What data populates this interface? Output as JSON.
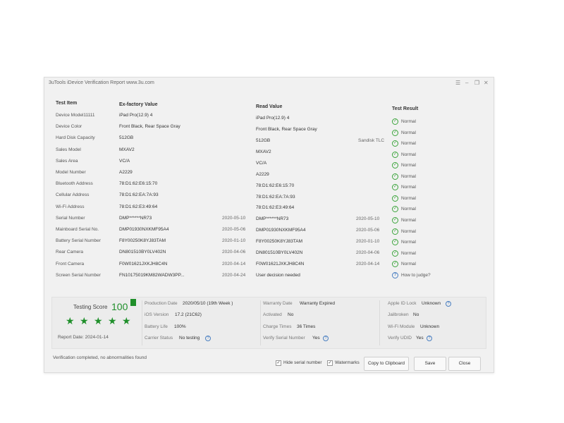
{
  "window": {
    "title": "3uTools iDevice Verification Report www.3u.com",
    "controls": {
      "menu": "☰",
      "minimize": "–",
      "restore": "❐",
      "close": "✕"
    }
  },
  "table": {
    "headers": {
      "item": "Test Item",
      "ex": "Ex-factory Value",
      "read": "Read Value",
      "result": "Test Result"
    },
    "rows": [
      {
        "item": "Device Model11111",
        "ex": "iPad Pro(12.9) 4",
        "ex_date": "",
        "read": "iPad Pro(12.9) 4",
        "read_date": "",
        "note": "",
        "result": "Normal"
      },
      {
        "item": "Device Color",
        "ex": "Front Black,  Rear Space Gray",
        "ex_date": "",
        "read": "Front Black,  Rear Space Gray",
        "read_date": "",
        "note": "",
        "result": "Normal"
      },
      {
        "item": "Hard Disk Capacity",
        "ex": "512GB",
        "ex_date": "",
        "read": "512GB",
        "read_date": "",
        "note": "Sandisk TLC",
        "result": "Normal"
      },
      {
        "item": "Sales Model",
        "ex": "MXAV2",
        "ex_date": "",
        "read": "MXAV2",
        "read_date": "",
        "note": "",
        "result": "Normal"
      },
      {
        "item": "Sales Area",
        "ex": "VC/A",
        "ex_date": "",
        "read": "VC/A",
        "read_date": "",
        "note": "",
        "result": "Normal"
      },
      {
        "item": "Model Number",
        "ex": "A2229",
        "ex_date": "",
        "read": "A2229",
        "read_date": "",
        "note": "",
        "result": "Normal"
      },
      {
        "item": "Bluetooth Address",
        "ex": "78:D1:62:E6:15:70",
        "ex_date": "",
        "read": "78:D1:62:E6:15:70",
        "read_date": "",
        "note": "",
        "result": "Normal"
      },
      {
        "item": "Cellular Address",
        "ex": "78:D1:62:EA:7A:93",
        "ex_date": "",
        "read": "78:D1:62:EA:7A:93",
        "read_date": "",
        "note": "",
        "result": "Normal"
      },
      {
        "item": "Wi-Fi Address",
        "ex": "78:D1:62:E3:49:64",
        "ex_date": "",
        "read": "78:D1:62:E3:49:64",
        "read_date": "",
        "note": "",
        "result": "Normal"
      },
      {
        "item": "Serial Number",
        "ex": "DMP******NR73",
        "ex_date": "2020-05-10",
        "read": "DMP******NR73",
        "read_date": "2020-05-10",
        "note": "",
        "result": "Normal"
      },
      {
        "item": "Mainboard Serial No.",
        "ex": "DMP01930NXKMF95A4",
        "ex_date": "2020-05-06",
        "read": "DMP01930NXKMF95A4",
        "read_date": "2020-05-06",
        "note": "",
        "result": "Normal"
      },
      {
        "item": "Battery Serial Number",
        "ex": "F8Y00250K8YJ83TAM",
        "ex_date": "2020-01-10",
        "read": "F8Y00250K8YJ83TAM",
        "read_date": "2020-01-10",
        "note": "",
        "result": "Normal"
      },
      {
        "item": "Rear Camera",
        "ex": "DN801510BY0LV402N",
        "ex_date": "2020-04-06",
        "read": "DN801510BY0LV402N",
        "read_date": "2020-04-06",
        "note": "",
        "result": "Normal"
      },
      {
        "item": "Front Camera",
        "ex": "F0W01621JXKJH8C4N",
        "ex_date": "2020-04-14",
        "read": "F0W01621JXKJH8C4N",
        "read_date": "2020-04-14",
        "note": "",
        "result": "Normal"
      },
      {
        "item": "Screen Serial Number",
        "ex": "FN10175019KM82WADW3PP...",
        "ex_date": "2020-04-24",
        "read": "User decision needed",
        "read_date": "",
        "note": "",
        "result": "How to judge?",
        "result_kind": "question"
      }
    ]
  },
  "summary": {
    "score_label": "Testing Score",
    "score": "100",
    "stars": 5,
    "report_date": "Report Date:  2024-01-14",
    "fields": {
      "production_date": {
        "label": "Production Date",
        "value": "2020/05/10 (19th Week )"
      },
      "ios_version": {
        "label": "iOS Version",
        "value": "17.2 (21C62)"
      },
      "battery_life": {
        "label": "Battery Life",
        "value": "100%"
      },
      "carrier_status": {
        "label": "Carrier Status",
        "value": "No testing"
      },
      "warranty_date": {
        "label": "Warranty Date",
        "value": "Warranty Expired"
      },
      "activated": {
        "label": "Activated",
        "value": "No"
      },
      "charge_times": {
        "label": "Charge Times",
        "value": "36 Times"
      },
      "verify_serial": {
        "label": "Verify Serial Number",
        "value": "Yes"
      },
      "apple_id_lock": {
        "label": "Apple ID Lock",
        "value": "Unknown"
      },
      "jailbroken": {
        "label": "Jailbroken",
        "value": "No"
      },
      "wifi_module": {
        "label": "Wi-Fi Module",
        "value": "Unknown"
      },
      "verify_udid": {
        "label": "Verify UDID",
        "value": "Yes"
      }
    }
  },
  "footer": {
    "status": "Verification completed, no abnormalities found",
    "hide_serial": {
      "label": "Hide serial number",
      "checked": true
    },
    "watermarks": {
      "label": "Watermarks",
      "checked": true
    },
    "buttons": {
      "copy": "Copy to Clipboard",
      "save": "Save",
      "close": "Close"
    }
  },
  "colors": {
    "accent_green": "#1f8f2a",
    "ok_green": "#3aa43a",
    "info_blue": "#4a7fc1",
    "window_bg": "#f1f1f1"
  }
}
